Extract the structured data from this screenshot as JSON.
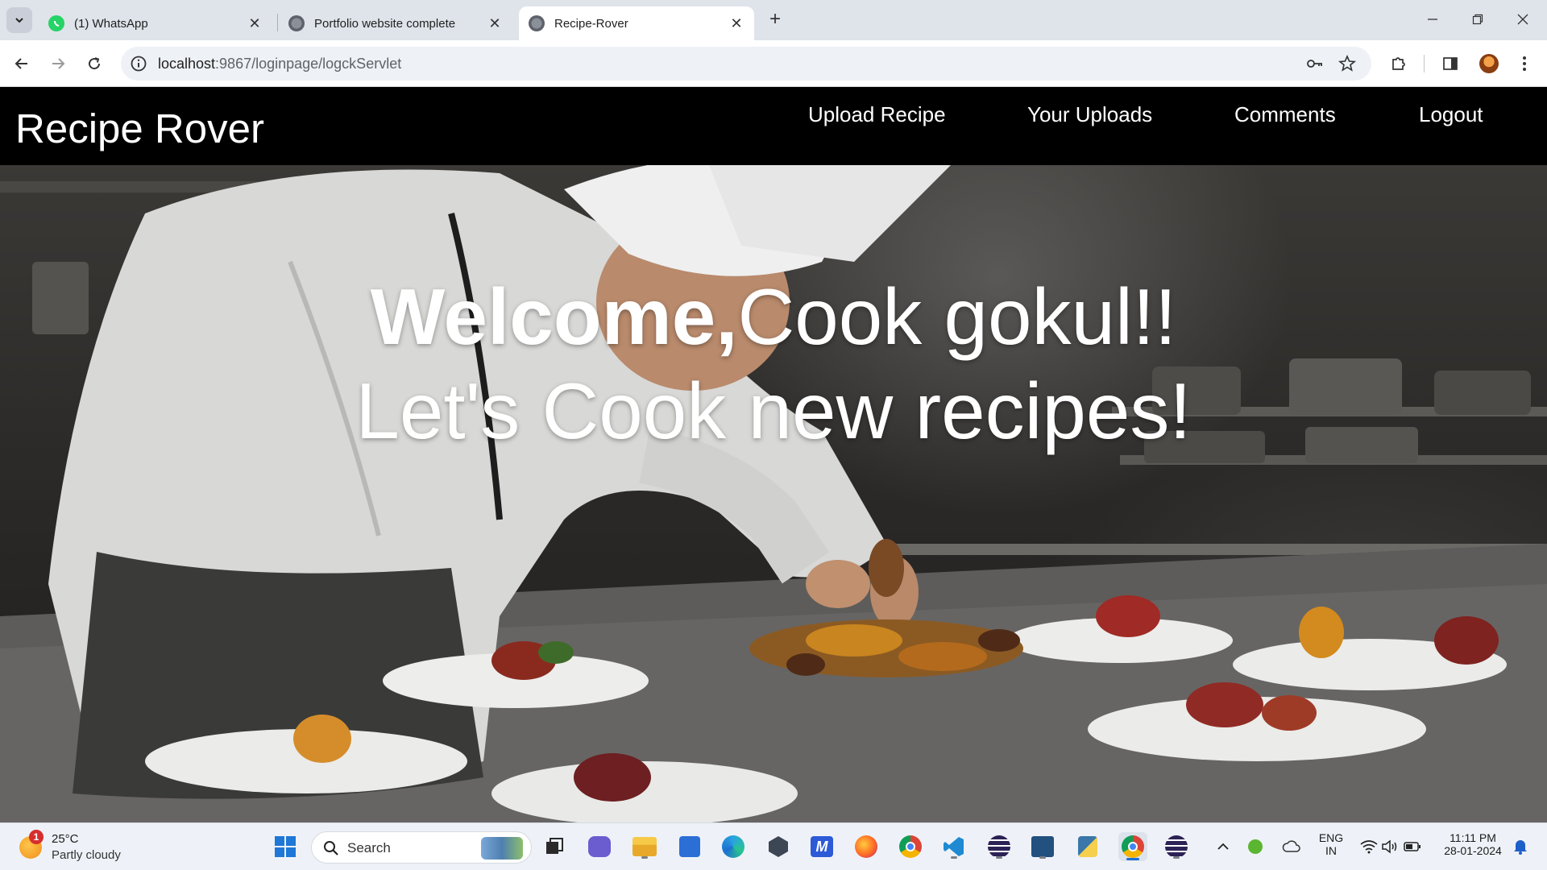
{
  "browser": {
    "tabs": [
      {
        "title": "(1) WhatsApp",
        "icon": "whatsapp-icon",
        "active": false
      },
      {
        "title": "Portfolio website complete",
        "icon": "globe-icon",
        "active": false
      },
      {
        "title": "Recipe-Rover",
        "icon": "globe-icon",
        "active": true
      }
    ],
    "url_host": "localhost",
    "url_rest": ":9867/loginpage/logckServlet"
  },
  "site": {
    "brand": "Recipe Rover",
    "nav": [
      "Upload Recipe",
      "Your Uploads",
      "Comments",
      "Logout"
    ],
    "hero": {
      "line1_bold": "Welcome,",
      "line1_rest": "Cook gokul!!",
      "line2": "Let's Cook new recipes!"
    }
  },
  "taskbar": {
    "weather": {
      "temp": "25°C",
      "desc": "Partly cloudy",
      "badge": "1"
    },
    "search_placeholder": "Search",
    "lang_line1": "ENG",
    "lang_line2": "IN",
    "time": "11:11 PM",
    "date": "28-01-2024"
  },
  "colors": {
    "header_bg": "#000000",
    "chrome_bg": "#dfe3ea",
    "taskbar_bg": "#eef2f8"
  }
}
